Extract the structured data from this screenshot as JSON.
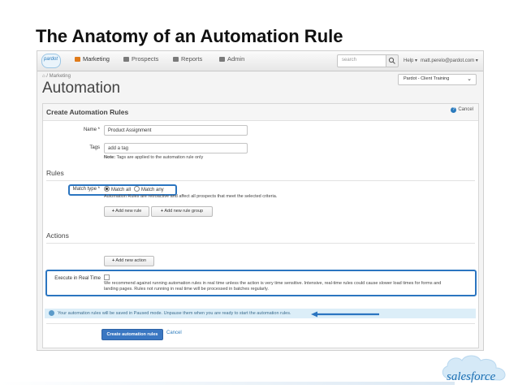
{
  "slide": {
    "title": "The Anatomy of an Automation Rule"
  },
  "nav": {
    "logo_text": "pardot",
    "items": [
      {
        "label": "Marketing",
        "icon": "pencil-icon"
      },
      {
        "label": "Prospects",
        "icon": "people-icon"
      },
      {
        "label": "Reports",
        "icon": "chart-icon"
      },
      {
        "label": "Admin",
        "icon": "briefcase-icon"
      }
    ],
    "search_placeholder": "search",
    "help_label": "Help",
    "user_label": "matt.perelo@pardot.com"
  },
  "header": {
    "breadcrumb": "Marketing",
    "page_title": "Automation",
    "account_select": "Pardot - Client Training"
  },
  "form": {
    "panel_title": "Create Automation Rules",
    "cancel_top": "Cancel",
    "name_label": "Name",
    "name_value": "Product Assignment",
    "tags_label": "Tags",
    "tags_placeholder": "add a tag",
    "tags_note_bold": "Note:",
    "tags_note": "Tags are applied to the automation rule only",
    "rules_section": "Rules",
    "match_type_label": "Match type",
    "match_all": "Match all",
    "match_any": "Match any",
    "rules_help": "Automation Rules are retroactive and affect all prospects that meet the selected criteria.",
    "add_rule": "Add new rule",
    "add_rule_group": "Add new rule group",
    "actions_section": "Actions",
    "add_action": "Add new action",
    "realtime_label": "Execute in Real Time",
    "realtime_help_1": "We recommend against running automation rules in real time unless the action is very time sensitive. Intensive, real-time rules could cause slower load times for forms and",
    "realtime_help_2": "landing pages. Rules not running in real time will be processed in batches regularly.",
    "info_message": "Your automation rules will be saved in Paused mode. Unpause them when you are ready to start the automation rules.",
    "create_button": "Create automation rules",
    "cancel_link": "Cancel"
  },
  "branding": {
    "logo_text": "salesforce"
  },
  "colors": {
    "highlight": "#2b75c0",
    "primary_button": "#3a77c2",
    "info_bg": "#dceef8",
    "marketing_accent": "#e07b1a"
  }
}
